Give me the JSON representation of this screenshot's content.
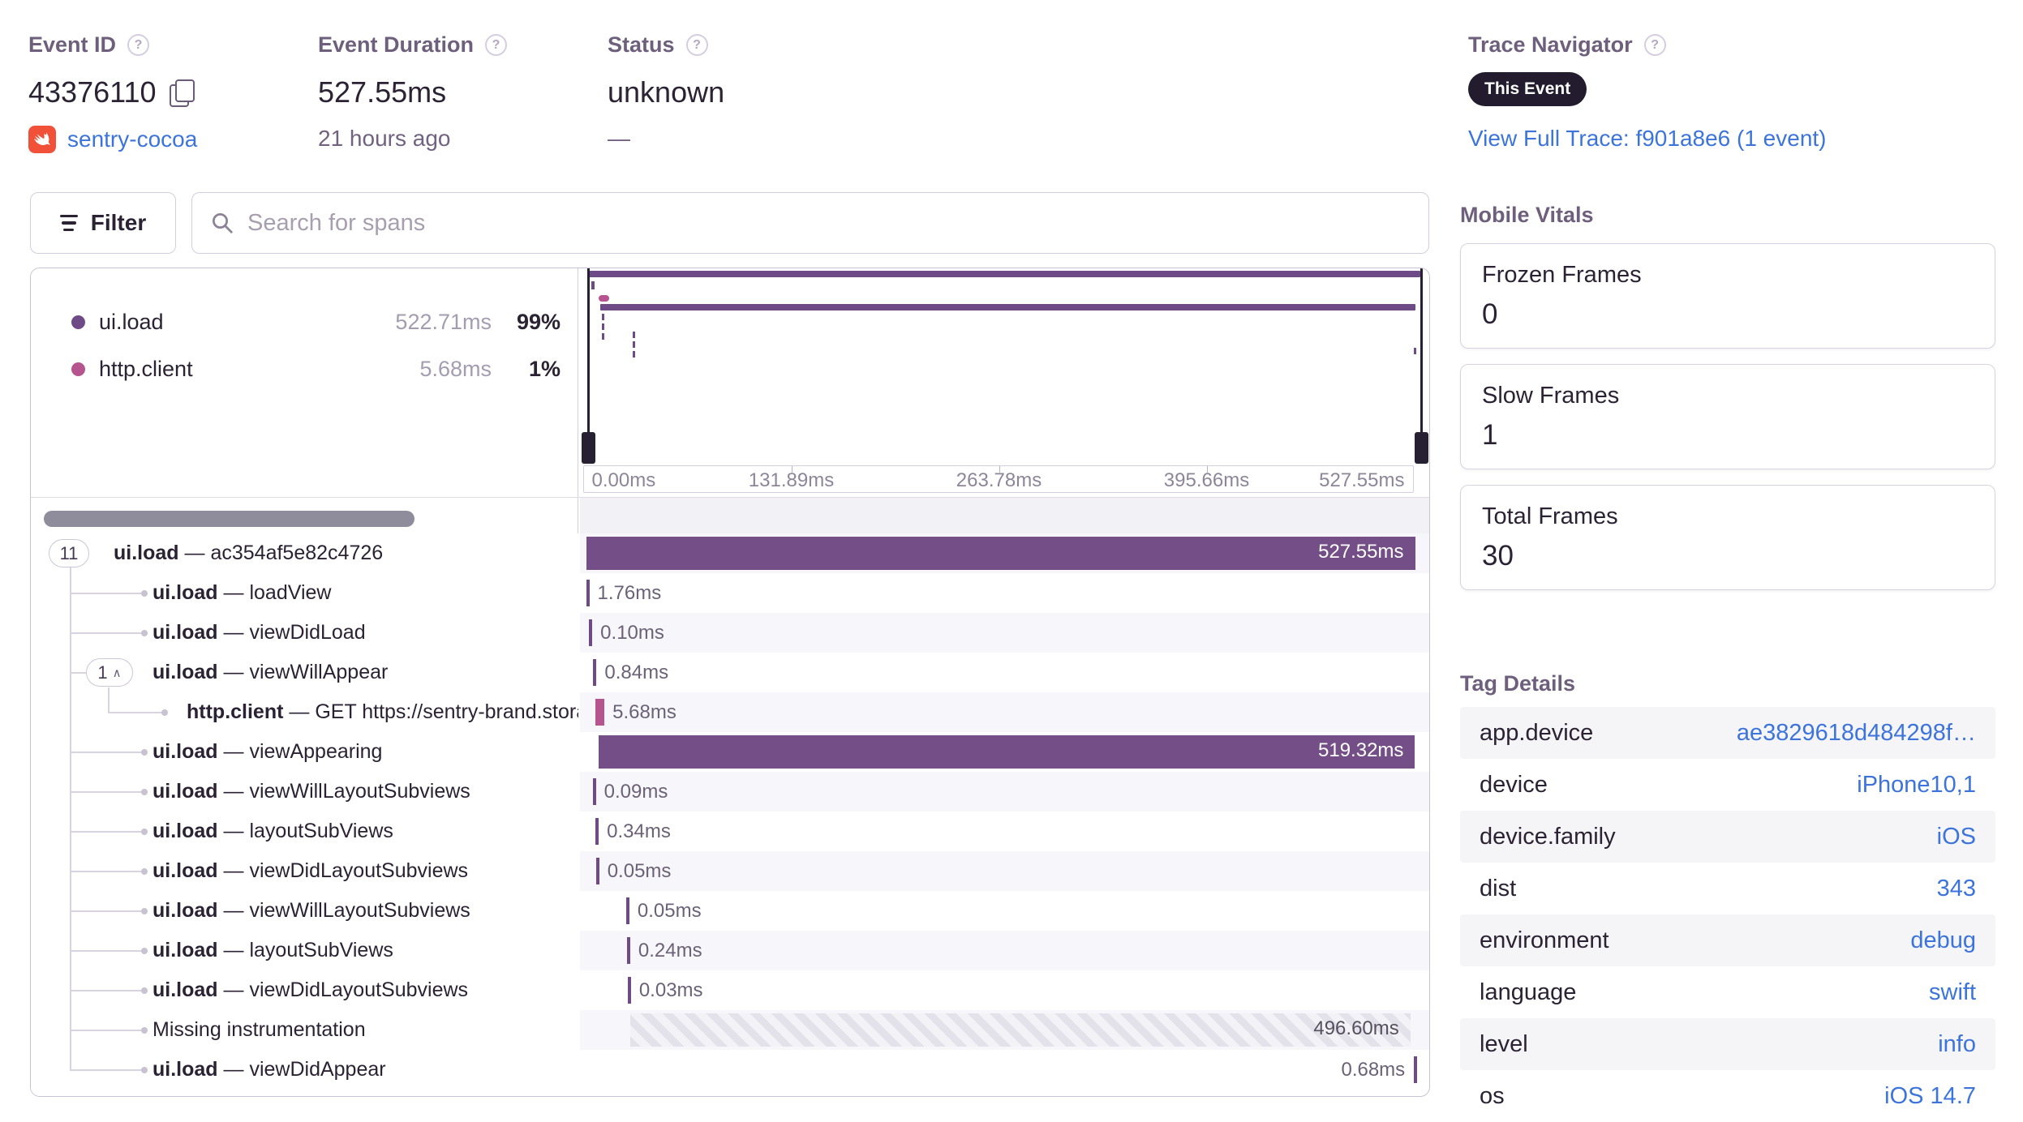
{
  "colors": {
    "purple": "#6e4a87",
    "purple_bar": "#744e87",
    "pink": "#b5548e",
    "dark": "#2b2233",
    "link": "#3c74db",
    "badge_bg": "#231c2e",
    "swift_orange": "#f05138"
  },
  "header": {
    "event_id": {
      "label": "Event ID",
      "value": "43376110",
      "project": "sentry-cocoa"
    },
    "duration": {
      "label": "Event Duration",
      "value": "527.55ms",
      "ago": "21 hours ago"
    },
    "status": {
      "label": "Status",
      "value": "unknown",
      "sub": "—"
    },
    "trace": {
      "label": "Trace Navigator",
      "badge": "This Event",
      "link": "View Full Trace: f901a8e6 (1 event)"
    }
  },
  "toolbar": {
    "filter_label": "Filter",
    "search_placeholder": "Search for spans"
  },
  "legend": [
    {
      "name": "ui.load",
      "duration": "522.71ms",
      "pct": "99%",
      "color": "#6e4a87"
    },
    {
      "name": "http.client",
      "duration": "5.68ms",
      "pct": "1%",
      "color": "#b5548e"
    }
  ],
  "axis": {
    "total_ms": 527.55,
    "ticks": [
      "0.00ms",
      "131.89ms",
      "263.78ms",
      "395.66ms",
      "527.55ms"
    ]
  },
  "spans": [
    {
      "badge": "11",
      "op": "ui.load",
      "desc": "ac354af5e82c4726",
      "depth": 0,
      "dur_label": "527.55ms",
      "start_ms": 0,
      "dur_ms": 527.55,
      "kind": "bar",
      "label_pos": "inside"
    },
    {
      "op": "ui.load",
      "desc": "loadView",
      "depth": 1,
      "dur_label": "1.76ms",
      "start_ms": 0,
      "dur_ms": 1.76,
      "kind": "tick",
      "label_pos": "right"
    },
    {
      "op": "ui.load",
      "desc": "viewDidLoad",
      "depth": 1,
      "dur_label": "0.10ms",
      "start_ms": 1.9,
      "dur_ms": 0.1,
      "kind": "tick",
      "label_pos": "right"
    },
    {
      "badge": "1",
      "badge_caret": "∧",
      "op": "ui.load",
      "desc": "viewWillAppear",
      "depth": 1,
      "dur_label": "0.84ms",
      "start_ms": 4.6,
      "dur_ms": 0.84,
      "kind": "tick",
      "label_pos": "right"
    },
    {
      "op": "http.client",
      "desc": "GET https://sentry-brand.stora",
      "depth": 2,
      "dur_label": "5.68ms",
      "start_ms": 6.0,
      "dur_ms": 5.68,
      "kind": "tick",
      "color": "pink",
      "label_pos": "right"
    },
    {
      "op": "ui.load",
      "desc": "viewAppearing",
      "depth": 1,
      "dur_label": "519.32ms",
      "start_ms": 8.2,
      "dur_ms": 519.32,
      "kind": "bar",
      "label_pos": "inside"
    },
    {
      "op": "ui.load",
      "desc": "viewWillLayoutSubviews",
      "depth": 1,
      "dur_label": "0.09ms",
      "start_ms": 4.2,
      "dur_ms": 0.09,
      "kind": "tick",
      "label_pos": "right"
    },
    {
      "op": "ui.load",
      "desc": "layoutSubViews",
      "depth": 1,
      "dur_label": "0.34ms",
      "start_ms": 6.0,
      "dur_ms": 0.34,
      "kind": "tick",
      "label_pos": "right"
    },
    {
      "op": "ui.load",
      "desc": "viewDidLayoutSubviews",
      "depth": 1,
      "dur_label": "0.05ms",
      "start_ms": 6.3,
      "dur_ms": 0.05,
      "kind": "tick",
      "label_pos": "right"
    },
    {
      "op": "ui.load",
      "desc": "viewWillLayoutSubviews",
      "depth": 1,
      "dur_label": "0.05ms",
      "start_ms": 25.5,
      "dur_ms": 0.05,
      "kind": "tick",
      "label_pos": "right"
    },
    {
      "op": "ui.load",
      "desc": "layoutSubViews",
      "depth": 1,
      "dur_label": "0.24ms",
      "start_ms": 26.0,
      "dur_ms": 0.24,
      "kind": "tick",
      "label_pos": "right"
    },
    {
      "op": "ui.load",
      "desc": "viewDidLayoutSubviews",
      "depth": 1,
      "dur_label": "0.03ms",
      "start_ms": 26.5,
      "dur_ms": 0.03,
      "kind": "tick",
      "label_pos": "right"
    },
    {
      "op": "",
      "desc": "Missing instrumentation",
      "depth": 1,
      "dur_label": "496.60ms",
      "start_ms": 28.0,
      "dur_ms": 496.6,
      "kind": "hatched",
      "label_pos": "inside"
    },
    {
      "op": "ui.load",
      "desc": "viewDidAppear",
      "depth": 1,
      "dur_label": "0.68ms",
      "start_ms": 526.6,
      "dur_ms": 0.68,
      "kind": "tick",
      "label_pos": "left"
    }
  ],
  "vitals": {
    "title": "Mobile Vitals",
    "cards": [
      {
        "label": "Frozen Frames",
        "value": "0"
      },
      {
        "label": "Slow Frames",
        "value": "1"
      },
      {
        "label": "Total Frames",
        "value": "30"
      }
    ]
  },
  "tags": {
    "title": "Tag Details",
    "rows": [
      {
        "key": "app.device",
        "value": "ae3829618d484298f…"
      },
      {
        "key": "device",
        "value": "iPhone10,1"
      },
      {
        "key": "device.family",
        "value": "iOS"
      },
      {
        "key": "dist",
        "value": "343"
      },
      {
        "key": "environment",
        "value": "debug"
      },
      {
        "key": "language",
        "value": "swift"
      },
      {
        "key": "level",
        "value": "info"
      },
      {
        "key": "os",
        "value": "iOS 14.7"
      }
    ]
  }
}
